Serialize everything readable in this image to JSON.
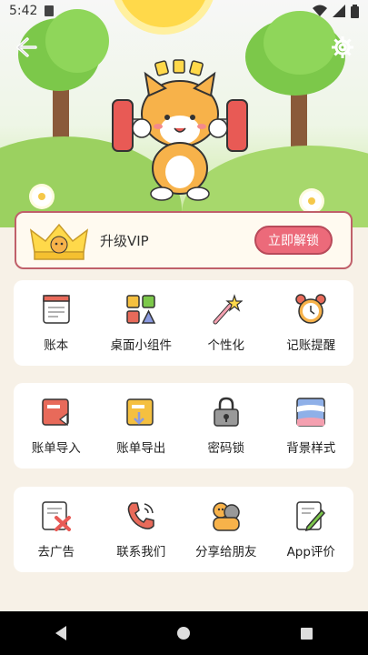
{
  "status_bar": {
    "time": "5:42",
    "icons": [
      "sim-card-icon",
      "wifi-icon",
      "signal-icon",
      "battery-icon"
    ]
  },
  "header": {
    "back_icon": "back-arrow-icon",
    "settings_icon": "gear-icon"
  },
  "vip": {
    "label": "升级VIP",
    "button": "立即解锁",
    "accent": "#ec6a7a"
  },
  "sections": [
    {
      "items": [
        {
          "label": "账本",
          "icon": "ledger-icon"
        },
        {
          "label": "桌面小组件",
          "icon": "widgets-icon"
        },
        {
          "label": "个性化",
          "icon": "magic-wand-icon"
        },
        {
          "label": "记账提醒",
          "icon": "alarm-clock-icon"
        }
      ]
    },
    {
      "items": [
        {
          "label": "账单导入",
          "icon": "bill-import-icon"
        },
        {
          "label": "账单导出",
          "icon": "bill-export-icon"
        },
        {
          "label": "密码锁",
          "icon": "lock-icon"
        },
        {
          "label": "背景样式",
          "icon": "background-style-icon"
        }
      ]
    },
    {
      "items": [
        {
          "label": "去广告",
          "icon": "remove-ads-icon"
        },
        {
          "label": "联系我们",
          "icon": "phone-icon"
        },
        {
          "label": "分享给朋友",
          "icon": "share-friends-icon"
        },
        {
          "label": "App评价",
          "icon": "review-icon"
        }
      ]
    }
  ],
  "nav": {
    "icons": [
      "nav-back-icon",
      "nav-home-icon",
      "nav-recent-icon"
    ]
  }
}
